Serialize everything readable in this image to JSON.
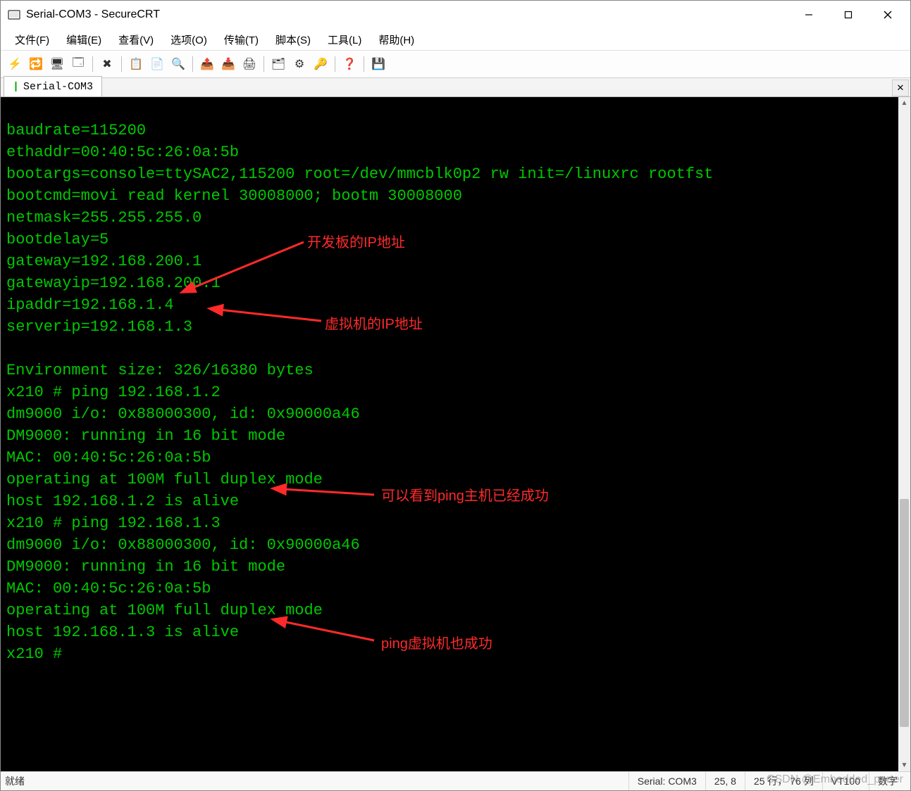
{
  "window": {
    "title": "Serial-COM3 - SecureCRT"
  },
  "menu": {
    "file": "文件(F)",
    "edit": "编辑(E)",
    "view": "查看(V)",
    "options": "选项(O)",
    "transfer": "传输(T)",
    "script": "脚本(S)",
    "tools": "工具(L)",
    "help": "帮助(H)"
  },
  "toolbar_icons": {
    "quick_connect": "⚡",
    "reconnect": "🔁",
    "new_session": "🖥",
    "disconnect": "🗔",
    "delete": "✖",
    "copy": "📋",
    "paste": "📄",
    "find": "🔍",
    "send": "📤",
    "receive": "📥",
    "print": "🖨",
    "props": "🗂",
    "settings": "⚙",
    "key": "🔑",
    "help": "❓",
    "save": "💾"
  },
  "tab": {
    "label": "Serial-COM3"
  },
  "terminal_lines": [
    "baudrate=115200",
    "ethaddr=00:40:5c:26:0a:5b",
    "bootargs=console=ttySAC2,115200 root=/dev/mmcblk0p2 rw init=/linuxrc rootfst",
    "bootcmd=movi read kernel 30008000; bootm 30008000",
    "netmask=255.255.255.0",
    "bootdelay=5",
    "gateway=192.168.200.1",
    "gatewayip=192.168.200.1",
    "ipaddr=192.168.1.4",
    "serverip=192.168.1.3",
    "",
    "Environment size: 326/16380 bytes",
    "x210 # ping 192.168.1.2",
    "dm9000 i/o: 0x88000300, id: 0x90000a46",
    "DM9000: running in 16 bit mode",
    "MAC: 00:40:5c:26:0a:5b",
    "operating at 100M full duplex mode",
    "host 192.168.1.2 is alive",
    "x210 # ping 192.168.1.3",
    "dm9000 i/o: 0x88000300, id: 0x90000a46",
    "DM9000: running in 16 bit mode",
    "MAC: 00:40:5c:26:0a:5b",
    "operating at 100M full duplex mode",
    "host 192.168.1.3 is alive",
    "x210 # "
  ],
  "annotations": {
    "a1": "开发板的IP地址",
    "a2": "虚拟机的IP地址",
    "a3": "可以看到ping主机已经成功",
    "a4": "ping虚拟机也成功"
  },
  "status": {
    "ready": "就绪",
    "serial": "Serial: COM3",
    "cursor": "25,  8",
    "size": "25 行， 76 列",
    "term": "VT100",
    "extra": "数字"
  },
  "watermark": "CSDN @Embedded_porter"
}
